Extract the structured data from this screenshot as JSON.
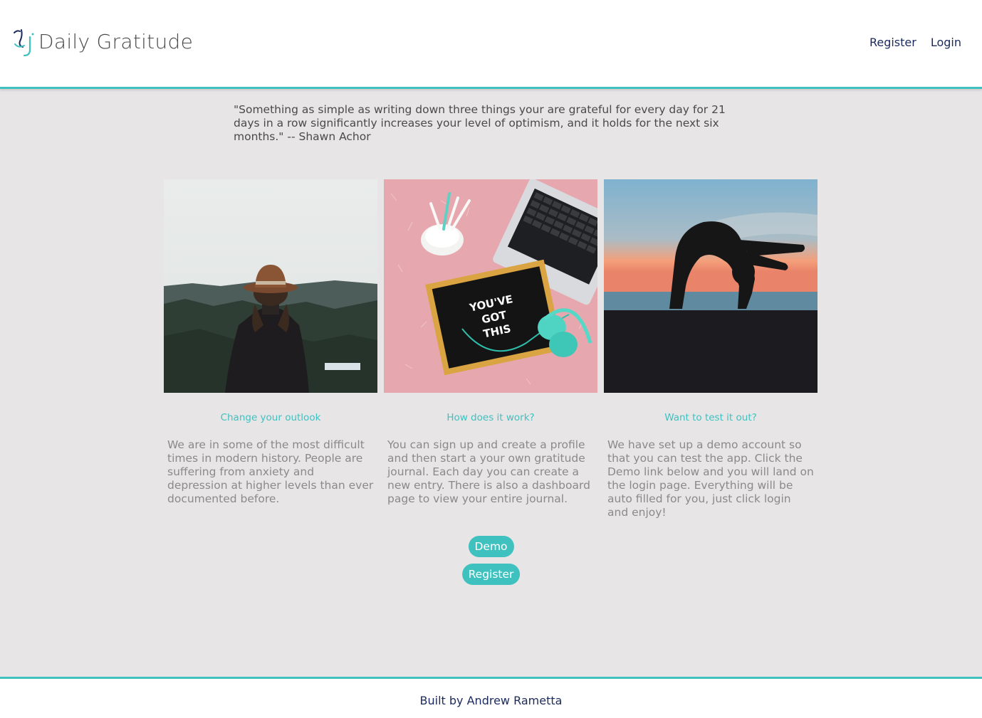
{
  "header": {
    "brand_name": "Daily Gratitude",
    "logo_icon": "dj-monogram-icon",
    "nav": [
      {
        "label": "Register"
      },
      {
        "label": "Login"
      }
    ]
  },
  "quote": "\"Something as simple as writing down three things your are grateful for every day for 21 days in a row significantly increases your level of optimism, and it holds for the next six months.\" -- Shawn Achor",
  "cards": [
    {
      "image": "woman-with-hat-forest-photo",
      "title": "Change your outlook",
      "text": "We are in some of the most difficult times in modern history. People are suffering from anxiety and depression at higher levels than ever documented before."
    },
    {
      "image": "letterboard-laptop-photo",
      "board_text": "YOU'VE GOT THIS",
      "title": "How does it work?",
      "text": "You can sign up and create a profile and then start a your own gratitude journal. Each day you can create a new entry. There is also a dashboard page to view your entire journal."
    },
    {
      "image": "yoga-sunset-silhouette-photo",
      "title": "Want to test it out?",
      "text": "We have set up a demo account so that you can test the app. Click the Demo link below and you will land on the login page. Everything will be auto filled for you, just click login and enjoy!"
    }
  ],
  "buttons": {
    "demo": "Demo",
    "register": "Register"
  },
  "footer": {
    "text": "Built by Andrew Rametta"
  },
  "colors": {
    "accent": "#3fc1c0",
    "navy": "#1b2a5c",
    "background": "#e7e5e6"
  }
}
